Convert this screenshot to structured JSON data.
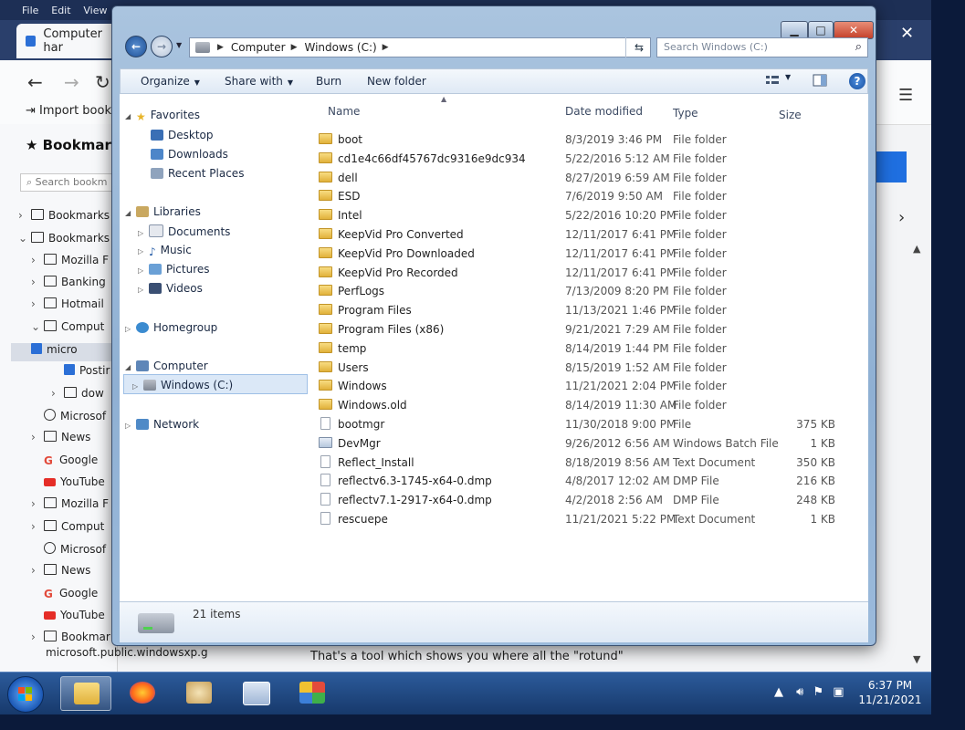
{
  "browser": {
    "menu": [
      "File",
      "Edit",
      "View"
    ],
    "tab_title": "Computer har",
    "import_label": "Import bookm",
    "sidebar_title": "Bookmark",
    "search_placeholder": "Search bookm",
    "bookmarks": [
      {
        "label": "Bookmarks",
        "icon": "bookmark-icon",
        "chev": "›"
      },
      {
        "label": "Bookmarks",
        "icon": "folder-icon",
        "chev": "⌄"
      },
      {
        "label": "Mozilla F",
        "icon": "folder-icon",
        "chev": "›"
      },
      {
        "label": "Banking",
        "icon": "folder-icon",
        "chev": "›"
      },
      {
        "label": "Hotmail",
        "icon": "folder-icon",
        "chev": "›"
      },
      {
        "label": "Comput",
        "icon": "folder-icon",
        "chev": "⌄"
      },
      {
        "label": "micro",
        "icon": "page-icon",
        "chev": ""
      },
      {
        "label": "Postir",
        "icon": "page-icon",
        "chev": ""
      },
      {
        "label": "dow",
        "icon": "folder-icon",
        "chev": "›"
      },
      {
        "label": "Microsof",
        "icon": "globe-icon",
        "chev": ""
      },
      {
        "label": "News",
        "icon": "folder-icon",
        "chev": "›"
      },
      {
        "label": "Google",
        "icon": "google-icon",
        "chev": ""
      },
      {
        "label": "YouTube",
        "icon": "youtube-icon",
        "chev": ""
      },
      {
        "label": "Mozilla F",
        "icon": "folder-icon",
        "chev": "›"
      },
      {
        "label": "Comput",
        "icon": "folder-icon",
        "chev": "›"
      },
      {
        "label": "Microsof",
        "icon": "globe-icon",
        "chev": ""
      },
      {
        "label": "News",
        "icon": "folder-icon",
        "chev": "›"
      },
      {
        "label": "Google",
        "icon": "google-icon",
        "chev": ""
      },
      {
        "label": "YouTube",
        "icon": "youtube-icon",
        "chev": ""
      },
      {
        "label": "Bookmar",
        "icon": "folder-icon",
        "chev": "›"
      }
    ],
    "bottom_tab": "microsoft.public.windowsxp.g",
    "caption": "That's a tool which shows you where all the \"rotund\""
  },
  "explorer": {
    "breadcrumb": [
      "Computer",
      "Windows (C:)"
    ],
    "search_placeholder": "Search Windows (C:)",
    "toolbar": {
      "organize": "Organize",
      "share_with": "Share with",
      "burn": "Burn",
      "new_folder": "New folder"
    },
    "nav_pane": {
      "favorites": "Favorites",
      "desktop": "Desktop",
      "downloads": "Downloads",
      "recent_places": "Recent Places",
      "libraries": "Libraries",
      "documents": "Documents",
      "music": "Music",
      "pictures": "Pictures",
      "videos": "Videos",
      "homegroup": "Homegroup",
      "computer": "Computer",
      "windows_c": "Windows (C:)",
      "network": "Network"
    },
    "columns": {
      "name": "Name",
      "date_modified": "Date modified",
      "type": "Type",
      "size": "Size"
    },
    "files": [
      {
        "name": "boot",
        "date": "8/3/2019 3:46 PM",
        "type": "File folder",
        "size": "",
        "kind": "folder"
      },
      {
        "name": "cd1e4c66df45767dc9316e9dc934",
        "date": "5/22/2016 5:12 AM",
        "type": "File folder",
        "size": "",
        "kind": "folder"
      },
      {
        "name": "dell",
        "date": "8/27/2019 6:59 AM",
        "type": "File folder",
        "size": "",
        "kind": "folder"
      },
      {
        "name": "ESD",
        "date": "7/6/2019 9:50 AM",
        "type": "File folder",
        "size": "",
        "kind": "folder"
      },
      {
        "name": "Intel",
        "date": "5/22/2016 10:20 PM",
        "type": "File folder",
        "size": "",
        "kind": "folder"
      },
      {
        "name": "KeepVid Pro Converted",
        "date": "12/11/2017 6:41 PM",
        "type": "File folder",
        "size": "",
        "kind": "folder"
      },
      {
        "name": "KeepVid Pro Downloaded",
        "date": "12/11/2017 6:41 PM",
        "type": "File folder",
        "size": "",
        "kind": "folder"
      },
      {
        "name": "KeepVid Pro Recorded",
        "date": "12/11/2017 6:41 PM",
        "type": "File folder",
        "size": "",
        "kind": "folder"
      },
      {
        "name": "PerfLogs",
        "date": "7/13/2009 8:20 PM",
        "type": "File folder",
        "size": "",
        "kind": "folder"
      },
      {
        "name": "Program Files",
        "date": "11/13/2021 1:46 PM",
        "type": "File folder",
        "size": "",
        "kind": "folder"
      },
      {
        "name": "Program Files (x86)",
        "date": "9/21/2021 7:29 AM",
        "type": "File folder",
        "size": "",
        "kind": "folder"
      },
      {
        "name": "temp",
        "date": "8/14/2019 1:44 PM",
        "type": "File folder",
        "size": "",
        "kind": "folder"
      },
      {
        "name": "Users",
        "date": "8/15/2019 1:52 AM",
        "type": "File folder",
        "size": "",
        "kind": "folder"
      },
      {
        "name": "Windows",
        "date": "11/21/2021 2:04 PM",
        "type": "File folder",
        "size": "",
        "kind": "folder"
      },
      {
        "name": "Windows.old",
        "date": "8/14/2019 11:30 AM",
        "type": "File folder",
        "size": "",
        "kind": "folder"
      },
      {
        "name": "bootmgr",
        "date": "11/30/2018 9:00 PM",
        "type": "File",
        "size": "375 KB",
        "kind": "file"
      },
      {
        "name": "DevMgr",
        "date": "9/26/2012 6:56 AM",
        "type": "Windows Batch File",
        "size": "1 KB",
        "kind": "bat"
      },
      {
        "name": "Reflect_Install",
        "date": "8/18/2019 8:56 AM",
        "type": "Text Document",
        "size": "350 KB",
        "kind": "file"
      },
      {
        "name": "reflectv6.3-1745-x64-0.dmp",
        "date": "4/8/2017 12:02 AM",
        "type": "DMP File",
        "size": "216 KB",
        "kind": "file"
      },
      {
        "name": "reflectv7.1-2917-x64-0.dmp",
        "date": "4/2/2018 2:56 AM",
        "type": "DMP File",
        "size": "248 KB",
        "kind": "file"
      },
      {
        "name": "rescuepe",
        "date": "11/21/2021 5:22 PM",
        "type": "Text Document",
        "size": "1 KB",
        "kind": "file"
      }
    ],
    "item_count": "21 items"
  },
  "taskbar": {
    "time": "6:37 PM",
    "date": "11/21/2021"
  },
  "colors": {
    "taskbar": "#1f4a86",
    "folder": "#e8c255",
    "selection": "#dbe8f7",
    "close_button": "#c4402a"
  }
}
